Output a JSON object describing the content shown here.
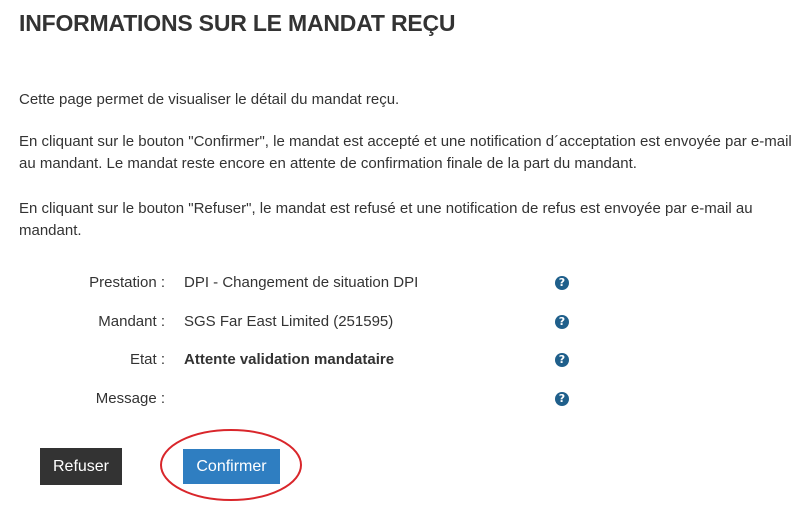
{
  "page": {
    "title": "INFORMATIONS SUR LE MANDAT REÇU"
  },
  "intro": {
    "paragraph1": "Cette page permet de visualiser le détail du mandat reçu.",
    "paragraph2": "En cliquant sur le bouton \"Confirmer\", le mandat est accepté et une notification d´acceptation est envoyée par e-mail au mandant. Le mandat reste encore en attente de confirmation finale de la part du mandant.",
    "paragraph3": "En cliquant sur le bouton \"Refuser\", le mandat est refusé et une notification de refus est envoyée par e-mail au mandant."
  },
  "details": {
    "prestation_label": "Prestation :",
    "prestation_value": "DPI - Changement de situation DPI",
    "mandant_label": "Mandant :",
    "mandant_value": "SGS Far East Limited (251595)",
    "etat_label": "Etat :",
    "etat_value": "Attente validation mandataire",
    "message_label": "Message :",
    "message_value": "",
    "help_glyph": "?"
  },
  "actions": {
    "refuser_label": "Refuser",
    "confirmer_label": "Confirmer"
  },
  "colors": {
    "refuser_bg": "#333333",
    "confirmer_bg": "#2f7ec1",
    "help_icon": "#1f5f8b",
    "annotation_circle": "#d9262b"
  },
  "icons": {
    "help": "question-circle-icon"
  }
}
